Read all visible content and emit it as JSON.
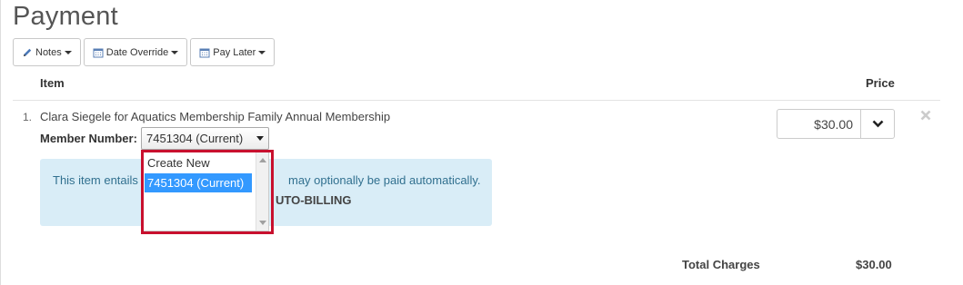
{
  "page": {
    "title": "Payment"
  },
  "toolbar": {
    "notes_label": "Notes",
    "date_override_label": "Date Override",
    "pay_later_label": "Pay Later"
  },
  "table": {
    "headers": {
      "item": "Item",
      "price": "Price"
    },
    "rows": [
      {
        "number": "1.",
        "description": "Clara Siegele for Aquatics Membership Family Annual Membership",
        "member_label": "Member Number:",
        "member_value": "7451304 (Current)",
        "member_options": [
          "Create New",
          "7451304 (Current)"
        ],
        "info_text_start": "This item entails",
        "info_text_end": "may optionally be paid automatically.",
        "info_bold": "UTO-BILLING",
        "price": "$30.00"
      }
    ]
  },
  "totals": {
    "label": "Total Charges",
    "value": "$30.00"
  },
  "colors": {
    "highlight": "#c8102e",
    "info_bg": "#d9edf7",
    "selection": "#3399ff"
  },
  "icons": [
    "pencil-icon",
    "calendar-icon",
    "chevron-down-icon",
    "close-icon"
  ]
}
